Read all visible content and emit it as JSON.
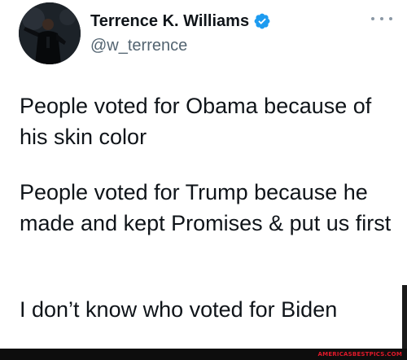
{
  "tweet": {
    "display_name": "Terrence K. Williams",
    "handle": "@w_terrence",
    "verified": true,
    "paragraphs": [
      "People voted for Obama because of his skin color",
      "People voted for Trump because he made and kept Promises & put us first",
      "I don’t know who voted for Biden"
    ]
  },
  "icons": {
    "verified": "verified-badge-icon",
    "more": "more-horizontal-icon"
  },
  "footer": {
    "watermark": "AMERICASBESTPICS.COM"
  },
  "colors": {
    "verified_blue": "#1d9bf0",
    "text": "#0f1419",
    "handle_gray": "#536471",
    "watermark_red": "#e0192a"
  }
}
